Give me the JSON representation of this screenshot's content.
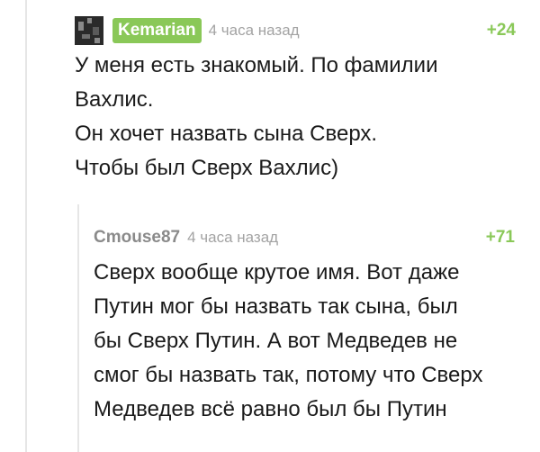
{
  "comments": [
    {
      "username": "Kemarian",
      "time": "4 часа назад",
      "rating": "+24",
      "paragraphs": [
        "У меня есть знакомый. По фамилии",
        "Вахлис.",
        "Он хочет назвать сына Сверх.",
        "Чтобы был Сверх Вахлис)"
      ]
    },
    {
      "username": "Cmouse87",
      "time": "4 часа назад",
      "rating": "+71",
      "paragraphs": [
        "Сверх вообще крутое имя. Вот даже",
        "Путин мог бы назвать так сына, был",
        "бы Сверх Путин. А вот Медведев не",
        "смог бы назвать так, потому что Сверх",
        "Медведев всё равно был бы Путин"
      ]
    }
  ]
}
